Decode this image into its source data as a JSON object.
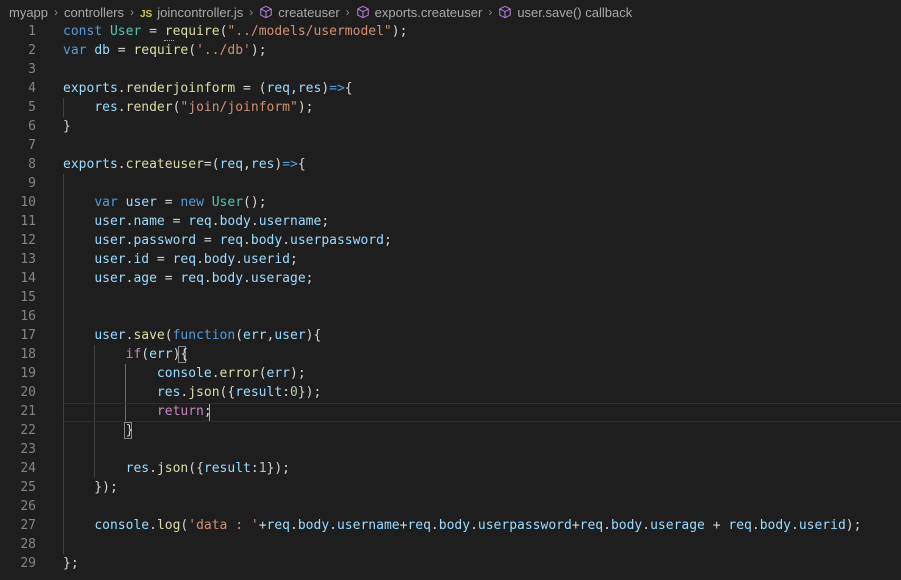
{
  "breadcrumb": {
    "folder1": "myapp",
    "folder2": "controllers",
    "file_badge": "JS",
    "file": "joincontroller.js",
    "symbol1": "createuser",
    "symbol2": "exports.createuser",
    "symbol3": "user.save() callback"
  },
  "icons": {
    "separator": "chevron-right-icon",
    "file": "javascript-file-icon",
    "symbol": "symbol-cube-icon"
  },
  "colors": {
    "background": "#1e1e1e",
    "keyword": "#569cd6",
    "control_keyword": "#c586c0",
    "variable": "#9cdcfe",
    "class": "#4ec9b0",
    "function": "#dcdcaa",
    "string": "#ce9178",
    "number": "#b5cea8",
    "symbol_icon": "#b180d7",
    "js_badge": "#cbcb41"
  },
  "editor": {
    "cursor_line": 21,
    "lines": [
      {
        "n": "1",
        "tokens": [
          [
            "k",
            "const "
          ],
          [
            "t",
            "User"
          ],
          [
            "o",
            " = "
          ],
          [
            "f",
            "require"
          ],
          [
            "o",
            "("
          ],
          [
            "s",
            "\"../models/usermodel\""
          ],
          [
            "o",
            ");"
          ]
        ]
      },
      {
        "n": "2",
        "tokens": [
          [
            "k",
            "var "
          ],
          [
            "v",
            "db"
          ],
          [
            "o",
            " = "
          ],
          [
            "f",
            "require"
          ],
          [
            "o",
            "("
          ],
          [
            "s",
            "'../db'"
          ],
          [
            "o",
            ");"
          ]
        ]
      },
      {
        "n": "3",
        "tokens": []
      },
      {
        "n": "4",
        "tokens": [
          [
            "v",
            "exports"
          ],
          [
            "o",
            "."
          ],
          [
            "f",
            "renderjoinform"
          ],
          [
            "o",
            " = ("
          ],
          [
            "v",
            "req"
          ],
          [
            "o",
            ","
          ],
          [
            "v",
            "res"
          ],
          [
            "o",
            ")"
          ],
          [
            "k",
            "=>"
          ],
          [
            "o",
            "{"
          ]
        ]
      },
      {
        "n": "5",
        "tokens": [
          [
            "o",
            "    "
          ],
          [
            "v",
            "res"
          ],
          [
            "o",
            "."
          ],
          [
            "f",
            "render"
          ],
          [
            "o",
            "("
          ],
          [
            "s",
            "\"join/joinform\""
          ],
          [
            "o",
            ");"
          ]
        ]
      },
      {
        "n": "6",
        "tokens": [
          [
            "o",
            "}"
          ]
        ]
      },
      {
        "n": "7",
        "tokens": []
      },
      {
        "n": "8",
        "tokens": [
          [
            "v",
            "exports"
          ],
          [
            "o",
            "."
          ],
          [
            "f",
            "createuser"
          ],
          [
            "o",
            "=("
          ],
          [
            "v",
            "req"
          ],
          [
            "o",
            ","
          ],
          [
            "v",
            "res"
          ],
          [
            "o",
            ")"
          ],
          [
            "k",
            "=>"
          ],
          [
            "o",
            "{"
          ]
        ]
      },
      {
        "n": "9",
        "tokens": []
      },
      {
        "n": "10",
        "tokens": [
          [
            "o",
            "    "
          ],
          [
            "k",
            "var "
          ],
          [
            "v",
            "user"
          ],
          [
            "o",
            " = "
          ],
          [
            "k",
            "new "
          ],
          [
            "t",
            "User"
          ],
          [
            "o",
            "();"
          ]
        ]
      },
      {
        "n": "11",
        "tokens": [
          [
            "o",
            "    "
          ],
          [
            "v",
            "user"
          ],
          [
            "o",
            "."
          ],
          [
            "v",
            "name"
          ],
          [
            "o",
            " = "
          ],
          [
            "v",
            "req"
          ],
          [
            "o",
            "."
          ],
          [
            "v",
            "body"
          ],
          [
            "o",
            "."
          ],
          [
            "v",
            "username"
          ],
          [
            "o",
            ";"
          ]
        ]
      },
      {
        "n": "12",
        "tokens": [
          [
            "o",
            "    "
          ],
          [
            "v",
            "user"
          ],
          [
            "o",
            "."
          ],
          [
            "v",
            "password"
          ],
          [
            "o",
            " = "
          ],
          [
            "v",
            "req"
          ],
          [
            "o",
            "."
          ],
          [
            "v",
            "body"
          ],
          [
            "o",
            "."
          ],
          [
            "v",
            "userpassword"
          ],
          [
            "o",
            ";"
          ]
        ]
      },
      {
        "n": "13",
        "tokens": [
          [
            "o",
            "    "
          ],
          [
            "v",
            "user"
          ],
          [
            "o",
            "."
          ],
          [
            "v",
            "id"
          ],
          [
            "o",
            " = "
          ],
          [
            "v",
            "req"
          ],
          [
            "o",
            "."
          ],
          [
            "v",
            "body"
          ],
          [
            "o",
            "."
          ],
          [
            "v",
            "userid"
          ],
          [
            "o",
            ";"
          ]
        ]
      },
      {
        "n": "14",
        "tokens": [
          [
            "o",
            "    "
          ],
          [
            "v",
            "user"
          ],
          [
            "o",
            "."
          ],
          [
            "v",
            "age"
          ],
          [
            "o",
            " = "
          ],
          [
            "v",
            "req"
          ],
          [
            "o",
            "."
          ],
          [
            "v",
            "body"
          ],
          [
            "o",
            "."
          ],
          [
            "v",
            "userage"
          ],
          [
            "o",
            ";"
          ]
        ]
      },
      {
        "n": "15",
        "tokens": []
      },
      {
        "n": "16",
        "tokens": []
      },
      {
        "n": "17",
        "tokens": [
          [
            "o",
            "    "
          ],
          [
            "v",
            "user"
          ],
          [
            "o",
            "."
          ],
          [
            "f",
            "save"
          ],
          [
            "o",
            "("
          ],
          [
            "k",
            "function"
          ],
          [
            "o",
            "("
          ],
          [
            "v",
            "err"
          ],
          [
            "o",
            ","
          ],
          [
            "v",
            "user"
          ],
          [
            "o",
            "){"
          ]
        ]
      },
      {
        "n": "18",
        "tokens": [
          [
            "o",
            "        "
          ],
          [
            "c",
            "if"
          ],
          [
            "o",
            "("
          ],
          [
            "v",
            "err"
          ],
          [
            "o",
            "){"
          ]
        ]
      },
      {
        "n": "19",
        "tokens": [
          [
            "o",
            "            "
          ],
          [
            "v",
            "console"
          ],
          [
            "o",
            "."
          ],
          [
            "f",
            "error"
          ],
          [
            "o",
            "("
          ],
          [
            "v",
            "err"
          ],
          [
            "o",
            ");"
          ]
        ]
      },
      {
        "n": "20",
        "tokens": [
          [
            "o",
            "            "
          ],
          [
            "v",
            "res"
          ],
          [
            "o",
            "."
          ],
          [
            "f",
            "json"
          ],
          [
            "o",
            "({"
          ],
          [
            "v",
            "result"
          ],
          [
            "o",
            ":"
          ],
          [
            "n",
            "0"
          ],
          [
            "o",
            "});"
          ]
        ]
      },
      {
        "n": "21",
        "tokens": [
          [
            "o",
            "            "
          ],
          [
            "c",
            "return"
          ],
          [
            "o",
            ";"
          ]
        ]
      },
      {
        "n": "22",
        "tokens": [
          [
            "o",
            "        }"
          ]
        ]
      },
      {
        "n": "23",
        "tokens": []
      },
      {
        "n": "24",
        "tokens": [
          [
            "o",
            "        "
          ],
          [
            "v",
            "res"
          ],
          [
            "o",
            "."
          ],
          [
            "f",
            "json"
          ],
          [
            "o",
            "({"
          ],
          [
            "v",
            "result"
          ],
          [
            "o",
            ":"
          ],
          [
            "n",
            "1"
          ],
          [
            "o",
            "});"
          ]
        ]
      },
      {
        "n": "25",
        "tokens": [
          [
            "o",
            "    });"
          ]
        ]
      },
      {
        "n": "26",
        "tokens": []
      },
      {
        "n": "27",
        "tokens": [
          [
            "o",
            "    "
          ],
          [
            "v",
            "console"
          ],
          [
            "o",
            "."
          ],
          [
            "f",
            "log"
          ],
          [
            "o",
            "("
          ],
          [
            "s",
            "'data : '"
          ],
          [
            "o",
            "+"
          ],
          [
            "v",
            "req"
          ],
          [
            "o",
            "."
          ],
          [
            "v",
            "body"
          ],
          [
            "o",
            "."
          ],
          [
            "v",
            "username"
          ],
          [
            "o",
            "+"
          ],
          [
            "v",
            "req"
          ],
          [
            "o",
            "."
          ],
          [
            "v",
            "body"
          ],
          [
            "o",
            "."
          ],
          [
            "v",
            "userpassword"
          ],
          [
            "o",
            "+"
          ],
          [
            "v",
            "req"
          ],
          [
            "o",
            "."
          ],
          [
            "v",
            "body"
          ],
          [
            "o",
            "."
          ],
          [
            "v",
            "userage"
          ],
          [
            "o",
            " + "
          ],
          [
            "v",
            "req"
          ],
          [
            "o",
            "."
          ],
          [
            "v",
            "body"
          ],
          [
            "o",
            "."
          ],
          [
            "v",
            "userid"
          ],
          [
            "o",
            ");"
          ]
        ]
      },
      {
        "n": "28",
        "tokens": []
      },
      {
        "n": "29",
        "tokens": [
          [
            "o",
            "};"
          ]
        ]
      }
    ]
  }
}
